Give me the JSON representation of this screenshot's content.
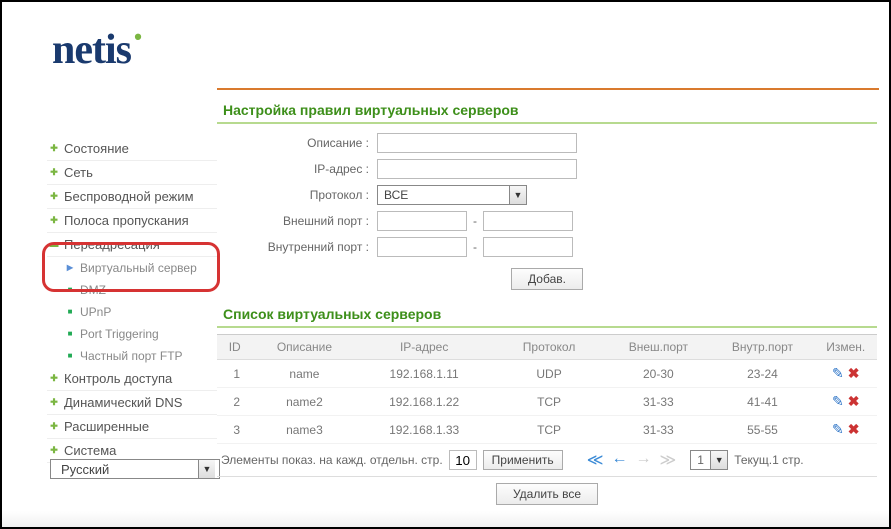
{
  "brand": {
    "name": "netis"
  },
  "sidebar": {
    "items": [
      {
        "label": "Состояние",
        "kind": "plus"
      },
      {
        "label": "Сеть",
        "kind": "plus"
      },
      {
        "label": "Беспроводной режим",
        "kind": "plus"
      },
      {
        "label": "Полоса пропускания",
        "kind": "plus"
      },
      {
        "label": "Переадресация",
        "kind": "minus"
      },
      {
        "label": "Виртуальный сервер",
        "kind": "box",
        "sub": true
      },
      {
        "label": "DMZ",
        "kind": "boxstop",
        "sub": true
      },
      {
        "label": "UPnP",
        "kind": "boxstop",
        "sub": true
      },
      {
        "label": "Port Triggering",
        "kind": "boxstop",
        "sub": true
      },
      {
        "label": "Частный порт FTP",
        "kind": "boxstop",
        "sub": true
      },
      {
        "label": "Контроль доступа",
        "kind": "plus"
      },
      {
        "label": "Динамический DNS",
        "kind": "plus"
      },
      {
        "label": "Расширенные",
        "kind": "plus"
      },
      {
        "label": "Система",
        "kind": "plus"
      }
    ],
    "language": "Русский"
  },
  "form": {
    "title": "Настройка правил виртуальных серверов",
    "labels": {
      "description": "Описание :",
      "ip": "IP-адрес :",
      "protocol": "Протокол :",
      "ext_port": "Внешний порт :",
      "int_port": "Внутренний порт :"
    },
    "protocol_value": "ВСЕ",
    "add_btn": "Добав."
  },
  "list": {
    "title": "Список виртуальных серверов",
    "headers": {
      "id": "ID",
      "desc": "Описание",
      "ip": "IP-адрес",
      "proto": "Протокол",
      "ext": "Внеш.порт",
      "int": "Внутр.порт",
      "mod": "Измен."
    },
    "rows": [
      {
        "id": "1",
        "desc": "name",
        "ip": "192.168.1.11",
        "proto": "UDP",
        "ext": "20-30",
        "int": "23-24"
      },
      {
        "id": "2",
        "desc": "name2",
        "ip": "192.168.1.22",
        "proto": "TCP",
        "ext": "31-33",
        "int": "41-41"
      },
      {
        "id": "3",
        "desc": "name3",
        "ip": "192.168.1.33",
        "proto": "TCP",
        "ext": "31-33",
        "int": "55-55"
      }
    ]
  },
  "pager": {
    "per_page_label": "Элементы показ. на кажд. отдельн. стр.",
    "per_page_value": "10",
    "apply_btn": "Применить",
    "page_value": "1",
    "current_label": "Текущ.1 стр."
  },
  "delete_all_btn": "Удалить все"
}
